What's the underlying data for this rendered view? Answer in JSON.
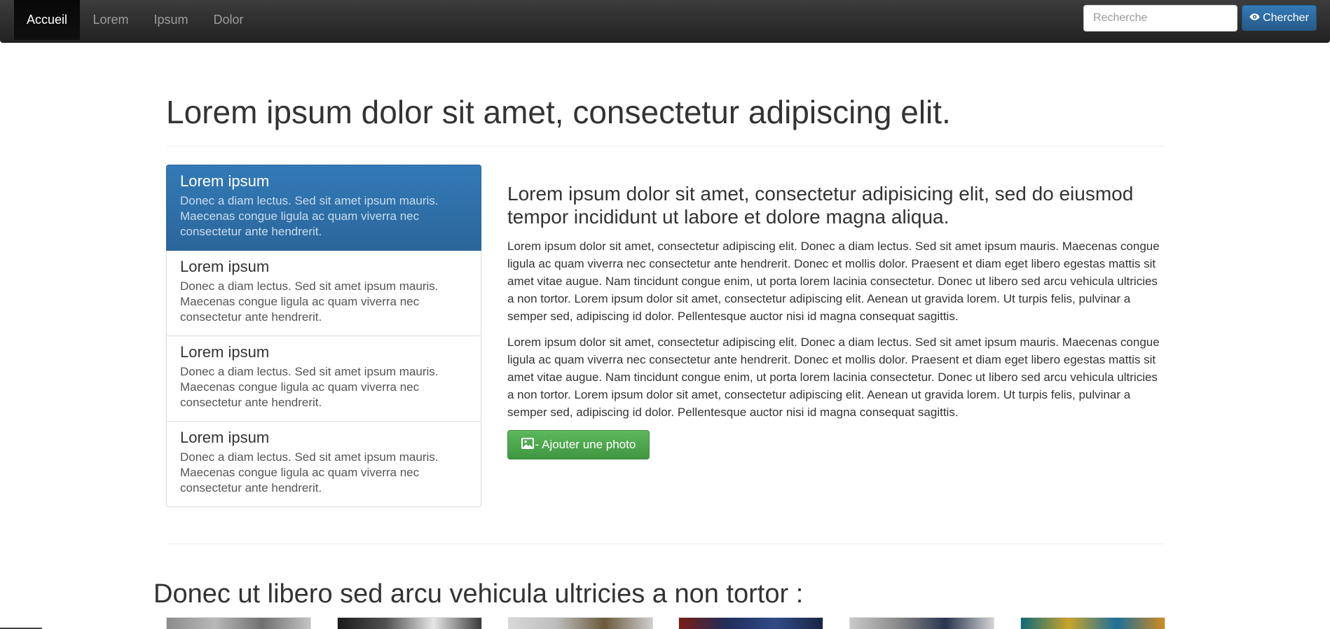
{
  "navbar": {
    "items": [
      {
        "label": "Accueil",
        "active": true
      },
      {
        "label": "Lorem",
        "active": false
      },
      {
        "label": "Ipsum",
        "active": false
      },
      {
        "label": "Dolor",
        "active": false
      }
    ],
    "search": {
      "placeholder": "Recherche",
      "value": ""
    },
    "search_button": {
      "label": "Chercher",
      "icon": "eye-icon"
    }
  },
  "header": {
    "title": "Lorem ipsum dolor sit amet, consectetur adipiscing elit."
  },
  "list_group": {
    "items": [
      {
        "heading": "Lorem ipsum",
        "text": "Donec a diam lectus. Sed sit amet ipsum mauris. Maecenas congue ligula ac quam viverra nec consectetur ante hendrerit.",
        "active": true
      },
      {
        "heading": "Lorem ipsum",
        "text": "Donec a diam lectus. Sed sit amet ipsum mauris. Maecenas congue ligula ac quam viverra nec consectetur ante hendrerit.",
        "active": false
      },
      {
        "heading": "Lorem ipsum",
        "text": "Donec a diam lectus. Sed sit amet ipsum mauris. Maecenas congue ligula ac quam viverra nec consectetur ante hendrerit.",
        "active": false
      },
      {
        "heading": "Lorem ipsum",
        "text": "Donec a diam lectus. Sed sit amet ipsum mauris. Maecenas congue ligula ac quam viverra nec consectetur ante hendrerit.",
        "active": false
      }
    ]
  },
  "main": {
    "heading": "Lorem ipsum dolor sit amet, consectetur adipisicing elit, sed do eiusmod tempor incididunt ut labore et dolore magna aliqua.",
    "paragraphs": [
      "Lorem ipsum dolor sit amet, consectetur adipiscing elit. Donec a diam lectus. Sed sit amet ipsum mauris. Maecenas congue ligula ac quam viverra nec consectetur ante hendrerit. Donec et mollis dolor. Praesent et diam eget libero egestas mattis sit amet vitae augue. Nam tincidunt congue enim, ut porta lorem lacinia consectetur. Donec ut libero sed arcu vehicula ultricies a non tortor. Lorem ipsum dolor sit amet, consectetur adipiscing elit. Aenean ut gravida lorem. Ut turpis felis, pulvinar a semper sed, adipiscing id dolor. Pellentesque auctor nisi id magna consequat sagittis.",
      "Lorem ipsum dolor sit amet, consectetur adipiscing elit. Donec a diam lectus. Sed sit amet ipsum mauris. Maecenas congue ligula ac quam viverra nec consectetur ante hendrerit. Donec et mollis dolor. Praesent et diam eget libero egestas mattis sit amet vitae augue. Nam tincidunt congue enim, ut porta lorem lacinia consectetur. Donec ut libero sed arcu vehicula ultricies a non tortor. Lorem ipsum dolor sit amet, consectetur adipiscing elit. Aenean ut gravida lorem. Ut turpis felis, pulvinar a semper sed, adipiscing id dolor. Pellentesque auctor nisi id magna consequat sagittis."
    ],
    "photo_button": {
      "label": "- Ajouter une photo",
      "icon": "picture-icon"
    }
  },
  "gallery": {
    "title": "Donec ut libero sed arcu vehicula ultricies a non tortor :",
    "thumbnail_count": 6
  },
  "colors": {
    "navbar": "#222222",
    "primary": "#337ab7",
    "success": "#5cb85c",
    "text": "#333333"
  }
}
